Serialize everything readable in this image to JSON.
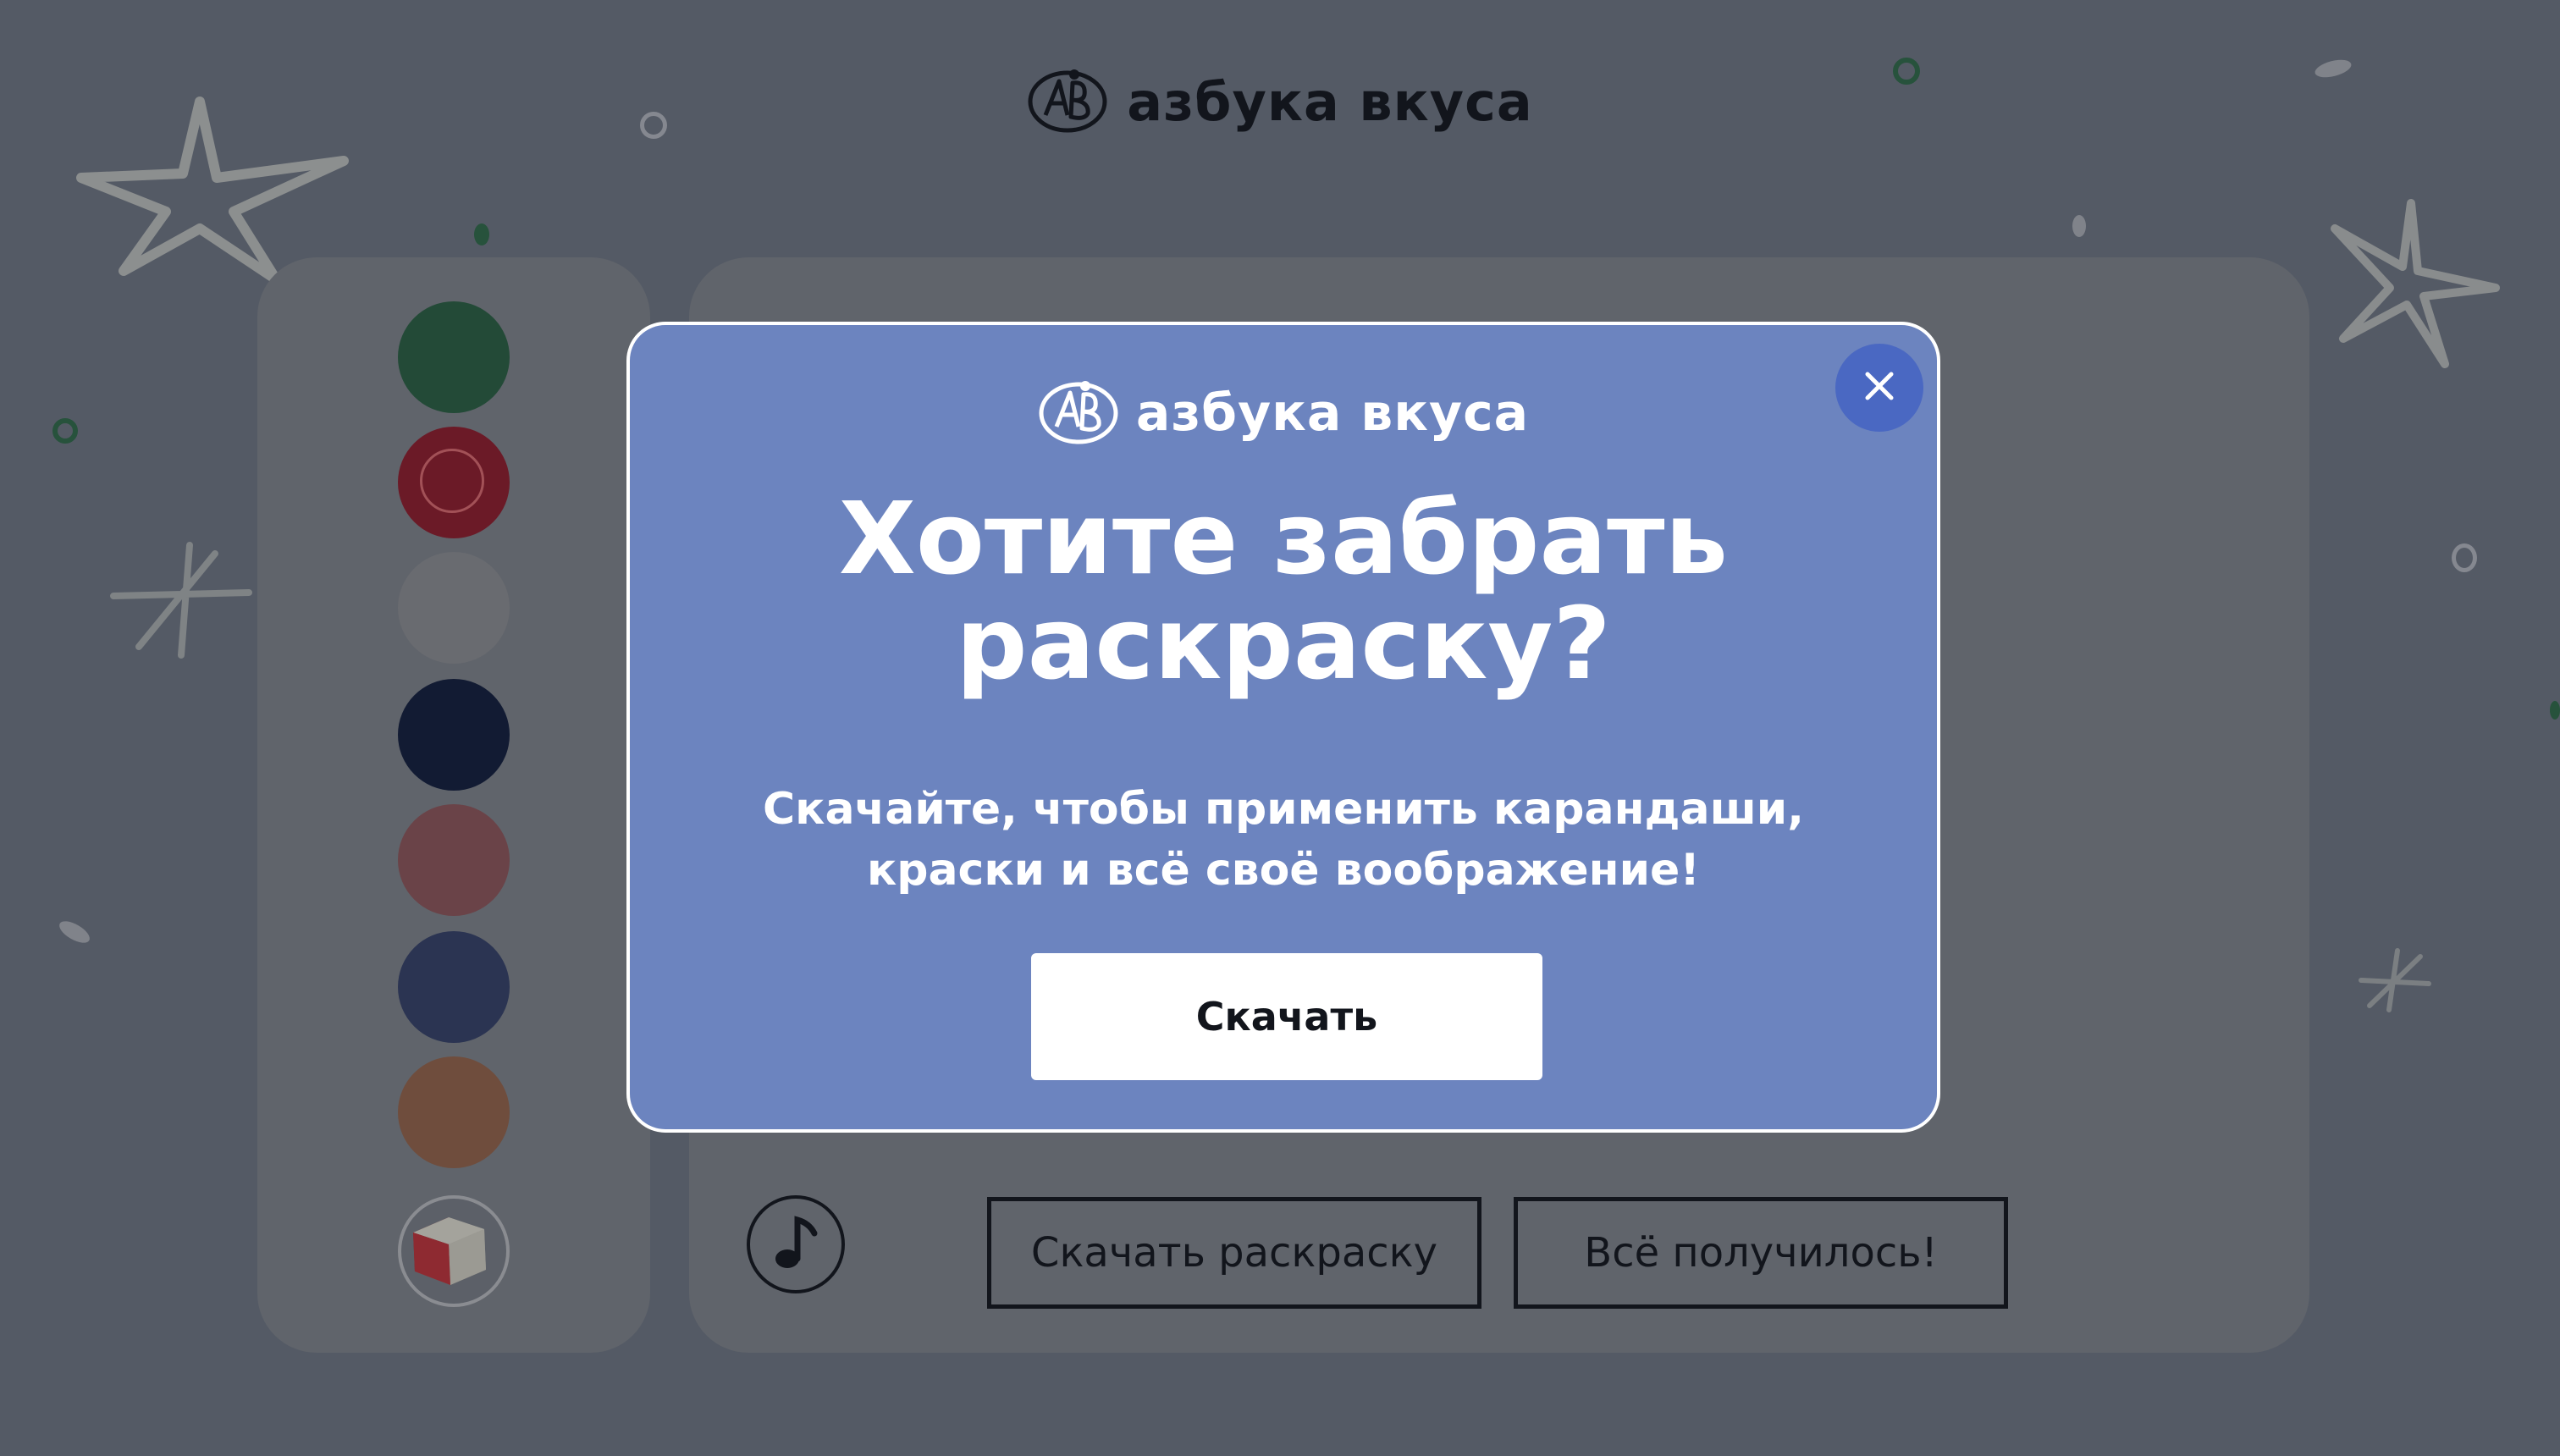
{
  "header": {
    "logo_text": "азбука вкуса"
  },
  "palette": {
    "colors": [
      "#234a37",
      "#6b1a27",
      "#696b70",
      "#121b33",
      "#6a4348",
      "#2b3452",
      "#6f4d3d"
    ],
    "selected_index": 1,
    "eraser_icon": "eraser-icon"
  },
  "canvas": {
    "music_icon": "music-note-icon",
    "download_coloring_label": "Скачать раскраску",
    "all_done_label": "Всё получилось!"
  },
  "modal": {
    "logo_text": "азбука вкуса",
    "title_line1": "Хотите забрать",
    "title_line2": "раскраску?",
    "text_line1": "Скачайте, чтобы применить карандаши,",
    "text_line2": "краски и всё своё воображение!",
    "download_label": "Скачать",
    "close_icon": "close-icon"
  },
  "colors": {
    "background": "#545a65",
    "panel": "#60646b",
    "modal": "#6c84bf",
    "close_button": "#4a68c2"
  }
}
